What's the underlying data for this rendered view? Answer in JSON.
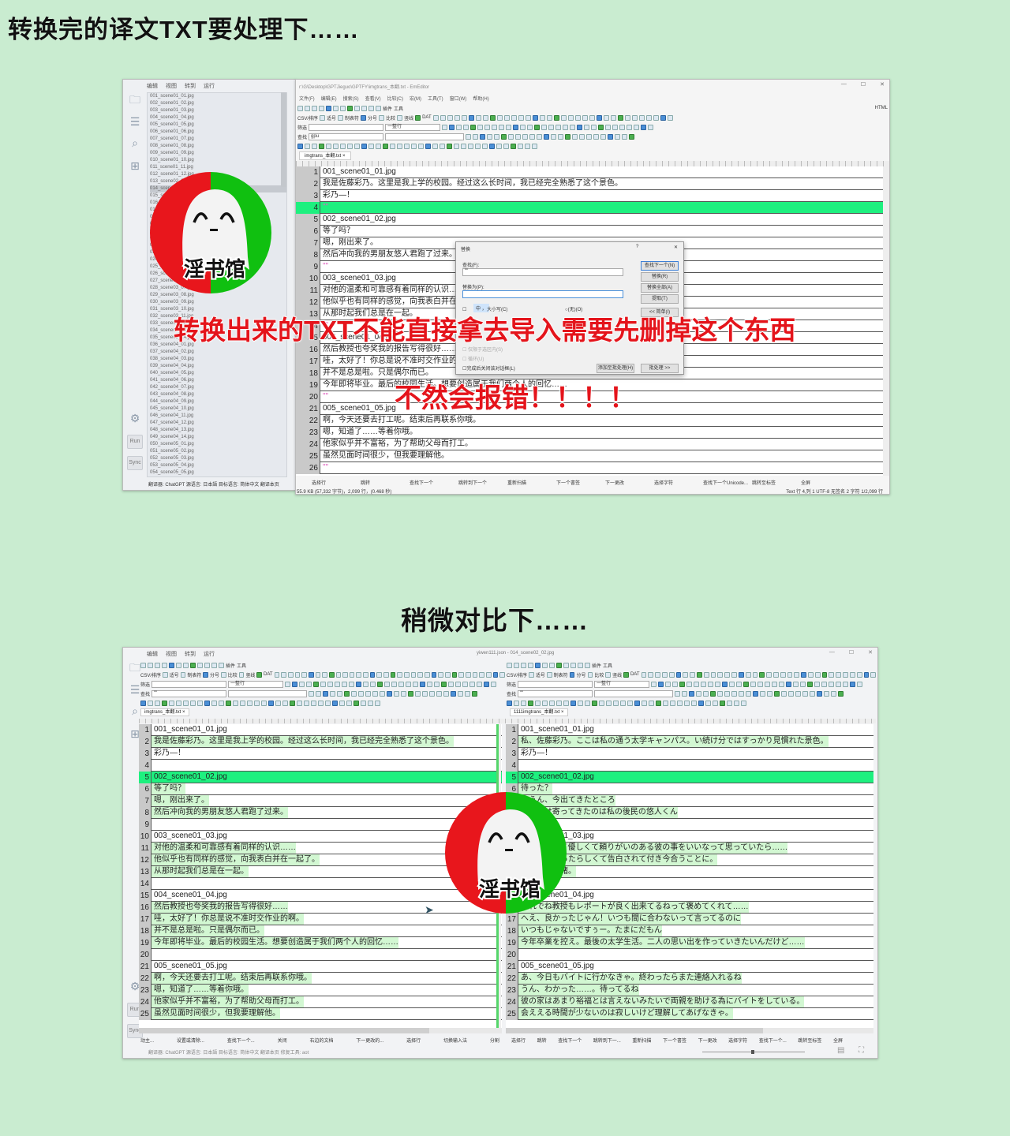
{
  "headings": {
    "top": "转换完的译文TXT要处理下……",
    "middle": "稍微对比下……"
  },
  "overlay": {
    "warning": "转换出来的TXT不能直接拿去导入需要先删掉这个东西",
    "error": "不然会报错！！！！"
  },
  "logo": {
    "text": "淫书馆"
  },
  "colors": {
    "background": "#c9ecd0",
    "current_line": "#1ef07f",
    "diff_highlight": "#d2f7d2",
    "overlay_red": "#e4141b",
    "logo_red": "#e8161c",
    "logo_green": "#10c010"
  },
  "sidepanel": {
    "menu": [
      "编辑",
      "视图",
      "转到",
      "运行"
    ],
    "files": [
      "001_scene01_01.jpg",
      "002_scene01_02.jpg",
      "003_scene01_03.jpg",
      "004_scene01_04.jpg",
      "005_scene01_05.jpg",
      "006_scene01_06.jpg",
      "007_scene01_07.jpg",
      "008_scene01_08.jpg",
      "009_scene01_09.jpg",
      "010_scene01_10.jpg",
      "011_scene01_11.jpg",
      "012_scene01_12.jpg",
      "013_scene02_01.jpg",
      "014_scene02_02.jpg",
      "015_scene02_03.jpg",
      "016_scene02_04.jpg",
      "017_scene02_05.jpg",
      "018_scene02_06.jpg",
      "019_scene02_07.jpg",
      "020_scene02_08.jpg",
      "021_scene02_09.jpg",
      "022_scene03_01.jpg",
      "023_scene03_02.jpg",
      "024_scene03_03.jpg",
      "025_scene03_04.jpg",
      "026_scene03_05.jpg",
      "027_scene03_06.jpg",
      "028_scene03_07.jpg",
      "029_scene03_08.jpg",
      "030_scene03_09.jpg",
      "031_scene03_10.jpg",
      "032_scene03_11.jpg",
      "033_scene03_12.jpg",
      "034_scene03_13.jpg",
      "035_scene03_14.jpg",
      "036_scene04_01.jpg",
      "037_scene04_02.jpg",
      "038_scene04_03.jpg",
      "039_scene04_04.jpg",
      "040_scene04_05.jpg",
      "041_scene04_06.jpg",
      "042_scene04_07.jpg",
      "043_scene04_08.jpg",
      "044_scene04_09.jpg",
      "045_scene04_10.jpg",
      "046_scene04_11.jpg",
      "047_scene04_12.jpg",
      "048_scene04_13.jpg",
      "049_scene04_14.jpg",
      "050_scene05_01.jpg",
      "051_scene05_02.jpg",
      "052_scene05_03.jpg",
      "053_scene05_04.jpg",
      "054_scene05_05.jpg"
    ],
    "selected_file": "014_scene02_02.jpg",
    "run_label": "Run",
    "sync_label": "Sync",
    "status": "翻译器: ChatGPT   源语言: 日本語   目标语言: 简体中文   翻译本页",
    "status_bottom": "翻译器: ChatGPT   源语言: 日本語   目标语言: 简体中文   翻译本页   修复工具: aot"
  },
  "editor": {
    "title": "r:\\G\\Desktop\\GPTJieguo\\GPTFY\\imgtrans_本翻.txt - EmEditor",
    "menu": [
      "文件(F)",
      "编辑(E)",
      "搜索(S)",
      "查看(V)",
      "比较(C)",
      "宏(M)",
      "工具(T)",
      "窗口(W)",
      "帮助(H)"
    ],
    "toolbar": {
      "plugin": "插件",
      "tools": "工具",
      "html": "HTML",
      "csv": "CSV/排序",
      "filter_label": "筛选",
      "whole_line": "一整行",
      "find_label": "查找",
      "find_value": "gpu",
      "bookmarks": [
        "适号",
        "制表符",
        "分号",
        "比较",
        "竖线",
        "DAT"
      ]
    },
    "tab": "imgtrans_本翻.txt",
    "lines": [
      {
        "n": 1,
        "t": "001_scene01_01.jpg"
      },
      {
        "n": 2,
        "t": "我是佐藤彩乃。这里是我上学的校园。经过这么长时间，我已经完全熟悉了这个景色。"
      },
      {
        "n": 3,
        "t": "彩乃—！"
      },
      {
        "n": 4,
        "t": "\"\"",
        "q": true,
        "cur": true
      },
      {
        "n": 5,
        "t": "002_scene01_02.jpg"
      },
      {
        "n": 6,
        "t": "等了吗？"
      },
      {
        "n": 7,
        "t": "嗯，刚出来了。"
      },
      {
        "n": 8,
        "t": "然后冲向我的男朋友悠人君跑了过来。"
      },
      {
        "n": 9,
        "t": "\"\"",
        "q": true
      },
      {
        "n": 10,
        "t": "003_scene01_03.jpg"
      },
      {
        "n": 11,
        "t": "对他的温柔和可靠感有着同样的认识……"
      },
      {
        "n": 12,
        "t": "他似乎也有同样的感觉，向我表白并在一起了。"
      },
      {
        "n": 13,
        "t": "从那时起我们总是在一起。"
      },
      {
        "n": 14,
        "t": "\"\"",
        "q": true
      },
      {
        "n": 15,
        "t": "004_scene01_04.jpg"
      },
      {
        "n": 16,
        "t": "然后教授也夸奖我的报告写得很好……"
      },
      {
        "n": 17,
        "t": "哇，太好了！你总是说不准时交作业的啊。"
      },
      {
        "n": 18,
        "t": "并不是总是啦。只是偶尔而已。"
      },
      {
        "n": 19,
        "t": "今年即将毕业。最后的校园生活。想要创造属于我们两个人的回忆……"
      },
      {
        "n": 20,
        "t": "\"\"",
        "q": true
      },
      {
        "n": 21,
        "t": "005_scene01_05.jpg"
      },
      {
        "n": 22,
        "t": "啊，今天还要去打工呢。结束后再联系你哦。"
      },
      {
        "n": 23,
        "t": "嗯，知道了……等着你哦。"
      },
      {
        "n": 24,
        "t": "他家似乎并不富裕，为了帮助父母而打工。"
      },
      {
        "n": 25,
        "t": "虽然见面时间很少，但我要理解他。"
      },
      {
        "n": 26,
        "t": "\"\"",
        "q": true
      }
    ],
    "bottom_bar": [
      "选择行",
      "跳转",
      "查找下一个",
      "跳转到下一个",
      "重新扫描",
      "下一个書签",
      "下一更改",
      "选择字符",
      "查找下一个Unicode...",
      "跳转至标签",
      "全屏"
    ],
    "status_left": "55.9 KB (57,332 字节)，2,099 行，(0.468 秒)",
    "status_right": "Text   行 4,列 1    UTF-8 无签名        2 字符  1/2,099 行"
  },
  "dialog": {
    "title": "替换",
    "find_label": "查找(F):",
    "find_value": "\"\"",
    "replace_label": "替换为(P):",
    "replace_value": "",
    "buttons": [
      "查找下一个(N)",
      "替换(R)",
      "替换全部(A)",
      "提取(T)",
      "<< 简单(I)"
    ],
    "ime": "中 ，",
    "options": [
      "大小写(C)",
      "仅限于选区内(S)",
      "循环(U)",
      "完成后关闭该对话框(L)"
    ],
    "radio": "(无)(O)",
    "batch_add": "添加至批处理(H)",
    "batch": "批处理 >>",
    "help": "?",
    "close": "✕"
  },
  "compare": {
    "title": "yiwen111.json - 014_scene02_02.jpg",
    "left_tab": "imgtrans_本翻.txt",
    "right_tab": "1111imgtrans_本翻.txt",
    "find_value": "\"\"",
    "left": [
      {
        "n": 1,
        "t": "001_scene01_01.jpg"
      },
      {
        "n": 2,
        "t": "我是佐藤彩乃。这里是我上学的校园。经过这么长时间，我已经完全熟悉了这个景色。",
        "c": true
      },
      {
        "n": 3,
        "t": "彩乃—！"
      },
      {
        "n": 4,
        "t": ""
      },
      {
        "n": 5,
        "t": "002_scene01_02.jpg",
        "cur": true
      },
      {
        "n": 6,
        "t": "等了吗？",
        "c": true
      },
      {
        "n": 7,
        "t": "嗯，刚出来了。",
        "c": true
      },
      {
        "n": 8,
        "t": "然后冲向我的男朋友悠人君跑了过来。",
        "c": true
      },
      {
        "n": 9,
        "t": ""
      },
      {
        "n": 10,
        "t": "003_scene01_03.jpg"
      },
      {
        "n": 11,
        "t": "对他的温柔和可靠感有着同样的认识……",
        "c": true
      },
      {
        "n": 12,
        "t": "他似乎也有同样的感觉，向我表白并在一起了。",
        "c": true
      },
      {
        "n": 13,
        "t": "从那时起我们总是在一起。",
        "c": true
      },
      {
        "n": 14,
        "t": ""
      },
      {
        "n": 15,
        "t": "004_scene01_04.jpg"
      },
      {
        "n": 16,
        "t": "然后教授也夸奖我的报告写得很好……",
        "c": true
      },
      {
        "n": 17,
        "t": "哇，太好了！你总是说不准时交作业的啊。",
        "c": true
      },
      {
        "n": 18,
        "t": "并不是总是啦。只是偶尔而已。",
        "c": true
      },
      {
        "n": 19,
        "t": "今年即将毕业。最后的校园生活。想要创造属于我们两个人的回忆……",
        "c": true
      },
      {
        "n": 20,
        "t": ""
      },
      {
        "n": 21,
        "t": "005_scene01_05.jpg"
      },
      {
        "n": 22,
        "t": "啊，今天还要去打工呢。结束后再联系你哦。",
        "c": true
      },
      {
        "n": 23,
        "t": "嗯，知道了……等着你哦。",
        "c": true
      },
      {
        "n": 24,
        "t": "他家似乎并不富裕，为了帮助父母而打工。",
        "c": true
      },
      {
        "n": 25,
        "t": "虽然见面时间很少，但我要理解他。",
        "c": true
      }
    ],
    "right": [
      {
        "n": 1,
        "t": "001_scene01_01.jpg"
      },
      {
        "n": 2,
        "t": "私、佐藤彩乃。ここは私の通う太学キャンパス。い続け分ではすっかり見慣れた景色。",
        "c": true
      },
      {
        "n": 3,
        "t": "彩乃—！"
      },
      {
        "n": 4,
        "t": ""
      },
      {
        "n": 5,
        "t": "002_scene01_02.jpg",
        "cur": true
      },
      {
        "n": 6,
        "t": "待った？",
        "c": true
      },
      {
        "n": 7,
        "t": "ううん、今出てきたところ",
        "c": true
      },
      {
        "n": 8,
        "t": "テム駆け寄ってきたのは私の後民の悠人くん",
        "c": true
      },
      {
        "n": 9,
        "t": ""
      },
      {
        "n": 10,
        "t": "003_scene01_03.jpg"
      },
      {
        "n": 11,
        "t": "で知へ白って優しくて頼りがいのある彼の事をいいなって思っていたら……",
        "c": true
      },
      {
        "n": 12,
        "t": "じ気持ちだったらしくて告白されて付き今合うことに。",
        "c": true
      },
      {
        "n": 13,
        "t": "はいつも一緒。",
        "c": true
      },
      {
        "n": 14,
        "t": ""
      },
      {
        "n": 15,
        "t": "004_scene01_04.jpg"
      },
      {
        "n": 16,
        "t": "それでね教授もレポートが良く出来てるねって褒めてくれて……",
        "c": true
      },
      {
        "n": 17,
        "t": "へえ、良かったじゃん！いつも間に合わないって言ってるのに",
        "c": true
      },
      {
        "n": 18,
        "t": "いつもじゃないですぅー。たまにだもん",
        "c": true
      },
      {
        "n": 19,
        "t": "今年卒業を控え。最後の太学生活。二人の思い出を作っていきたいんだけど……",
        "c": true
      },
      {
        "n": 20,
        "t": ""
      },
      {
        "n": 21,
        "t": "005_scene01_05.jpg"
      },
      {
        "n": 22,
        "t": "あ、今日もバイトに行かなきゃ。終わったらまた連絡入れるね",
        "c": true
      },
      {
        "n": 23,
        "t": "うん、わかった……。待ってるね",
        "c": true
      },
      {
        "n": 24,
        "t": "彼の家はあまり裕福とは言えないみたいで両親を助ける為にバイトをしている。",
        "c": true
      },
      {
        "n": 25,
        "t": "会ええる時間が少ないのは寂しいけど理解してあげなきゃ。",
        "c": true
      }
    ],
    "left_bar": [
      "动主...",
      "设置或清除...",
      "查找下一个...",
      "关闭",
      "右边的文档",
      "下一更改的...",
      "选择行",
      "切换输入法",
      "分割"
    ],
    "right_bar": [
      "选择行",
      "跳转",
      "查找下一个",
      "跳转到下一...",
      "重新扫描",
      "下一个書签",
      "下一更改",
      "选择字符",
      "查找下一个...",
      "跳转至标签",
      "全屏"
    ]
  }
}
